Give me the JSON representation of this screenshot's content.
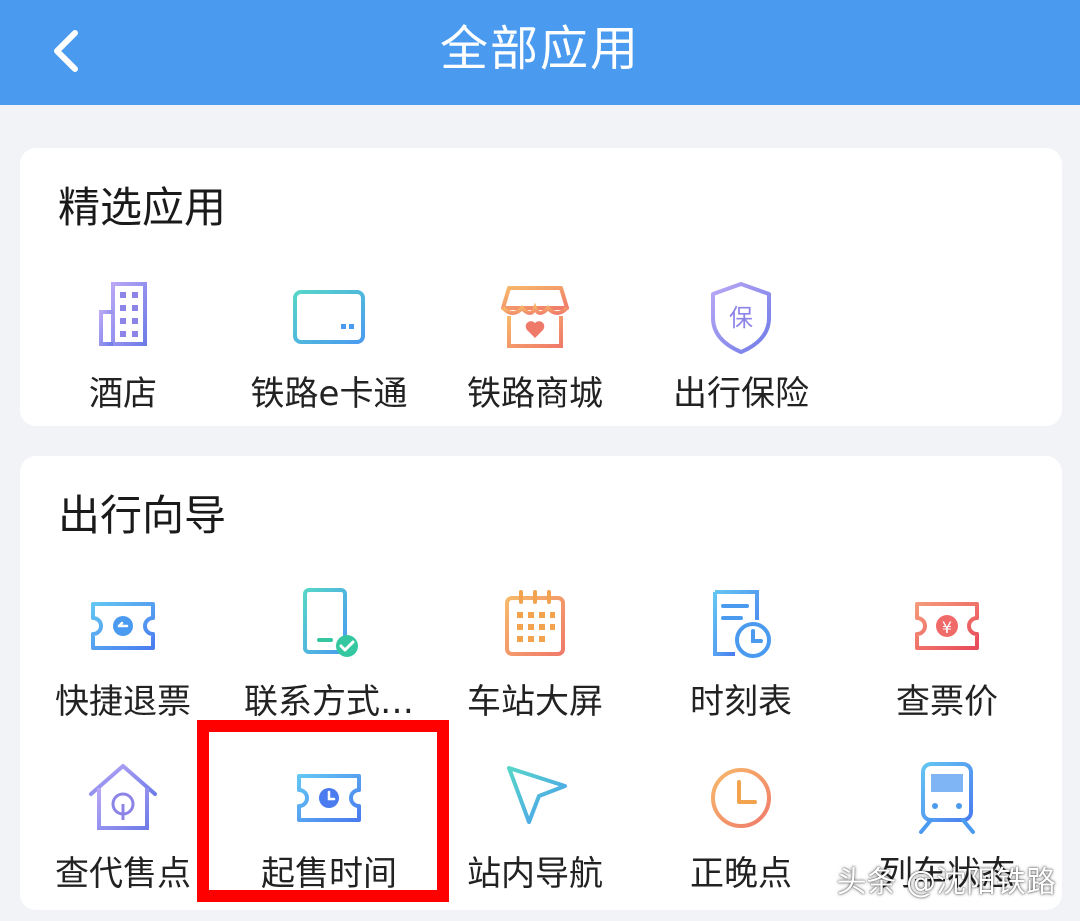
{
  "header": {
    "title": "全部应用",
    "back_icon": "chevron-left-icon"
  },
  "featured": {
    "title": "精选应用",
    "apps": [
      {
        "label": "酒店",
        "icon": "building-icon"
      },
      {
        "label": "铁路e卡通",
        "icon": "card-icon"
      },
      {
        "label": "铁路商城",
        "icon": "shop-icon"
      },
      {
        "label": "出行保险",
        "icon": "shield-icon"
      }
    ]
  },
  "guide": {
    "title": "出行向导",
    "apps": [
      {
        "label": "快捷退票",
        "icon": "ticket-refund-icon"
      },
      {
        "label": "联系方式…",
        "icon": "phone-check-icon"
      },
      {
        "label": "车站大屏",
        "icon": "calendar-screen-icon"
      },
      {
        "label": "时刻表",
        "icon": "timetable-icon"
      },
      {
        "label": "查票价",
        "icon": "ticket-price-icon"
      },
      {
        "label": "查代售点",
        "icon": "house-icon"
      },
      {
        "label": "起售时间",
        "icon": "ticket-clock-icon"
      },
      {
        "label": "站内导航",
        "icon": "navigation-arrow-icon"
      },
      {
        "label": "正晚点",
        "icon": "clock-icon"
      },
      {
        "label": "列车状态",
        "icon": "train-icon"
      }
    ]
  },
  "watermark": "头条 @沈阳铁路",
  "colors": {
    "header": "#4a9bf0",
    "page_bg": "#f1f3f6",
    "highlight": "#ff0000",
    "icon_blue": "#4a9bf0",
    "icon_purple": "#8d84e8",
    "icon_green": "#35c8a0",
    "icon_orange": "#f3a24e",
    "icon_red": "#f06a6a"
  }
}
